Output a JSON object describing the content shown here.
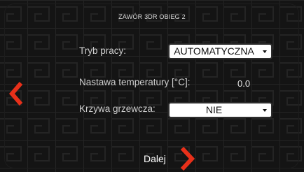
{
  "header": {
    "title": "ZAWÓR 3DR OBIEG 2"
  },
  "form": {
    "mode_label": "Tryb pracy:",
    "mode_value": "AUTOMATYCZNA",
    "setpoint_label": "Nastawa temperatury [°C]:",
    "setpoint_value": "0.0",
    "curve_label": "Krzywa grzewcza:",
    "curve_value": "NIE"
  },
  "footer": {
    "next_label": "Dalej"
  },
  "colors": {
    "accent": "#e8301a",
    "background": "#141414",
    "field": "#ffffff"
  },
  "icons": {
    "back": "chevron-left-icon",
    "next": "chevron-right-icon"
  }
}
